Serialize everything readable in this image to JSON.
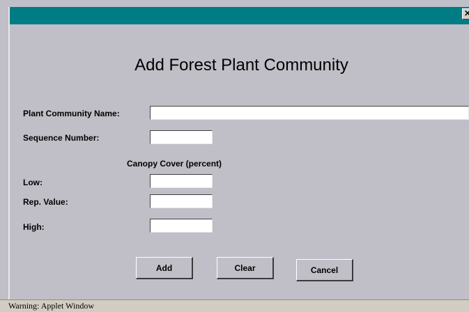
{
  "window": {
    "close_glyph": "×"
  },
  "form": {
    "title": "Add Forest Plant Community",
    "community_name_label": "Plant Community Name:",
    "community_name_value": "",
    "sequence_label": "Sequence Number:",
    "sequence_value": "",
    "canopy_heading": "Canopy Cover (percent)",
    "low_label": "Low:",
    "low_value": "",
    "rep_label": "Rep. Value:",
    "rep_value": "",
    "high_label": "High:",
    "high_value": ""
  },
  "buttons": {
    "add": "Add",
    "clear": "Clear",
    "cancel": "Cancel"
  },
  "status": {
    "text": "Warning: Applet Window"
  },
  "colors": {
    "titlebar": "#007c84",
    "background": "#c0bfc7",
    "statusbar": "#d2cdc2"
  }
}
